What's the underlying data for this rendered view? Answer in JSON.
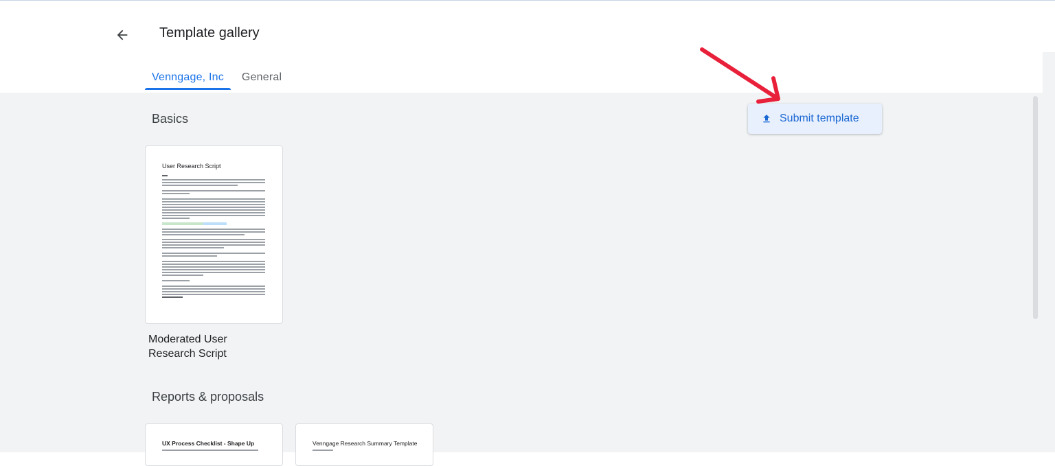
{
  "header": {
    "back_icon": "arrow-left-icon",
    "title": "Template gallery",
    "tabs": [
      {
        "label": "Venngage, Inc",
        "active": true
      },
      {
        "label": "General",
        "active": false
      }
    ]
  },
  "actions": {
    "submit_label": "Submit template",
    "submit_icon": "upload-icon"
  },
  "sections": [
    {
      "title": "Basics",
      "templates": [
        {
          "thumb_title": "User Research Script",
          "label": "Moderated User Research Script"
        }
      ]
    },
    {
      "title": "Reports & proposals",
      "templates": [
        {
          "thumb_title": "UX Process Checklist - Shape Up"
        },
        {
          "thumb_title": "Venngage Research Summary Template"
        }
      ]
    }
  ],
  "colors": {
    "accent": "#1a73e8",
    "annotation_arrow": "#e8203a",
    "background": "#f1f3f4"
  }
}
